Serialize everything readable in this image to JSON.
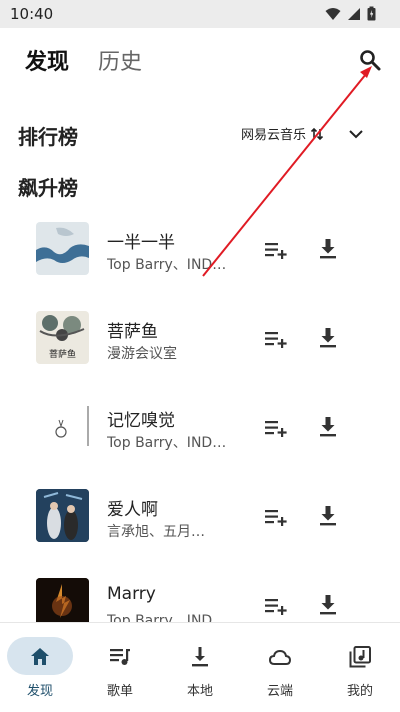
{
  "status_bar": {
    "time": "10:40"
  },
  "header": {
    "tab_discover": "发现",
    "tab_history": "历史"
  },
  "ranking": {
    "title": "排行榜",
    "source": "网易云音乐"
  },
  "chart_list": {
    "title": "飙升榜"
  },
  "songs": [
    {
      "title": "一半一半",
      "artist": "Top Barry、IND…"
    },
    {
      "title": "菩萨鱼",
      "artist": "漫游会议室"
    },
    {
      "title": "记忆嗅觉",
      "artist": "Top Barry、IND…"
    },
    {
      "title": "爱人啊",
      "artist": "言承旭、五月…"
    },
    {
      "title": "Marry",
      "artist": "Top Barry、IND…"
    }
  ],
  "bottom_nav": {
    "items": [
      {
        "label": "发现",
        "icon": "home-icon",
        "active": true
      },
      {
        "label": "歌单",
        "icon": "playlist-icon"
      },
      {
        "label": "本地",
        "icon": "download-icon"
      },
      {
        "label": "云端",
        "icon": "cloud-icon"
      },
      {
        "label": "我的",
        "icon": "library-music-icon"
      }
    ]
  },
  "colors": {
    "accent": "#1f4f6b",
    "active_pill": "#d7e4ee",
    "annotation_arrow": "#e01b24"
  },
  "cover_art_text": {
    "song_2": "菩萨鱼"
  }
}
